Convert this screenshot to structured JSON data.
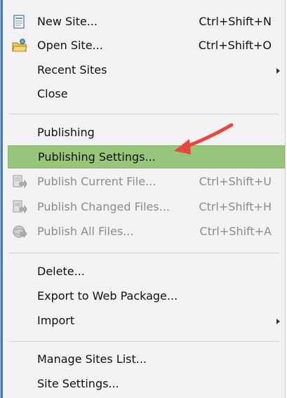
{
  "menu": {
    "items": [
      {
        "label": "New Site...",
        "shortcut": "Ctrl+Shift+N",
        "icon": "new-site-icon",
        "enabled": true
      },
      {
        "label": "Open Site...",
        "shortcut": "Ctrl+Shift+O",
        "icon": "open-site-icon",
        "enabled": true
      },
      {
        "label": "Recent Sites",
        "shortcut": "",
        "submenu": true,
        "enabled": true
      },
      {
        "label": "Close",
        "shortcut": "",
        "enabled": true
      },
      {
        "label": "Publishing",
        "shortcut": "",
        "enabled": true
      },
      {
        "label": "Publishing Settings...",
        "shortcut": "",
        "enabled": true,
        "highlighted": true
      },
      {
        "label": "Publish Current File...",
        "shortcut": "Ctrl+Shift+U",
        "icon": "publish-file-icon",
        "enabled": false
      },
      {
        "label": "Publish Changed Files...",
        "shortcut": "Ctrl+Shift+H",
        "icon": "publish-changed-icon",
        "enabled": false
      },
      {
        "label": "Publish All Files...",
        "shortcut": "Ctrl+Shift+A",
        "icon": "publish-all-icon",
        "enabled": false
      },
      {
        "label": "Delete...",
        "shortcut": "",
        "enabled": true
      },
      {
        "label": "Export to Web Package...",
        "shortcut": "",
        "enabled": true
      },
      {
        "label": "Import",
        "shortcut": "",
        "submenu": true,
        "enabled": true
      },
      {
        "label": "Manage Sites List...",
        "shortcut": "",
        "enabled": true
      },
      {
        "label": "Site Settings...",
        "shortcut": "",
        "enabled": true
      }
    ]
  },
  "colors": {
    "highlight": "#97c67a",
    "annotation_arrow": "#e8463f",
    "disabled_text": "#8c8c8c"
  }
}
